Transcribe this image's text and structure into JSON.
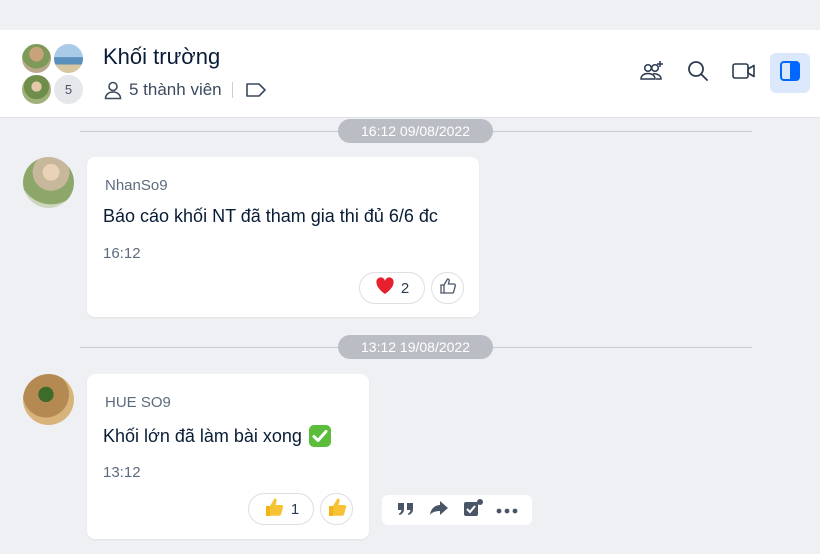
{
  "header": {
    "title": "Khối trường",
    "member_count_label": "5 thành viên",
    "extra_member_count": "5",
    "colors": {
      "accent": "#0068ff",
      "active_bg": "#dbe8fb"
    }
  },
  "header_actions": [
    {
      "name": "add-member-icon"
    },
    {
      "name": "search-icon"
    },
    {
      "name": "video-call-icon"
    },
    {
      "name": "sidebar-toggle-icon",
      "active": true
    }
  ],
  "timeline": [
    {
      "date": "16:12 09/08/2022"
    },
    {
      "date": "13:12 19/08/2022"
    }
  ],
  "messages": [
    {
      "sender": "NhanSo9",
      "text": "Báo cáo khối NT đã tham gia thi đủ 6/6 đc",
      "time": "16:12",
      "reaction": {
        "icon": "heart-icon",
        "count": "2"
      }
    },
    {
      "sender": "HUE SO9",
      "text": "Khối lớn đã làm bài xong",
      "status_emoji": "✅",
      "time": "13:12",
      "reaction": {
        "icon": "thumbs-up-icon",
        "count": "1"
      }
    }
  ],
  "message_actions": [
    {
      "name": "quote-icon"
    },
    {
      "name": "forward-icon"
    },
    {
      "name": "task-icon"
    },
    {
      "name": "more-icon"
    }
  ]
}
